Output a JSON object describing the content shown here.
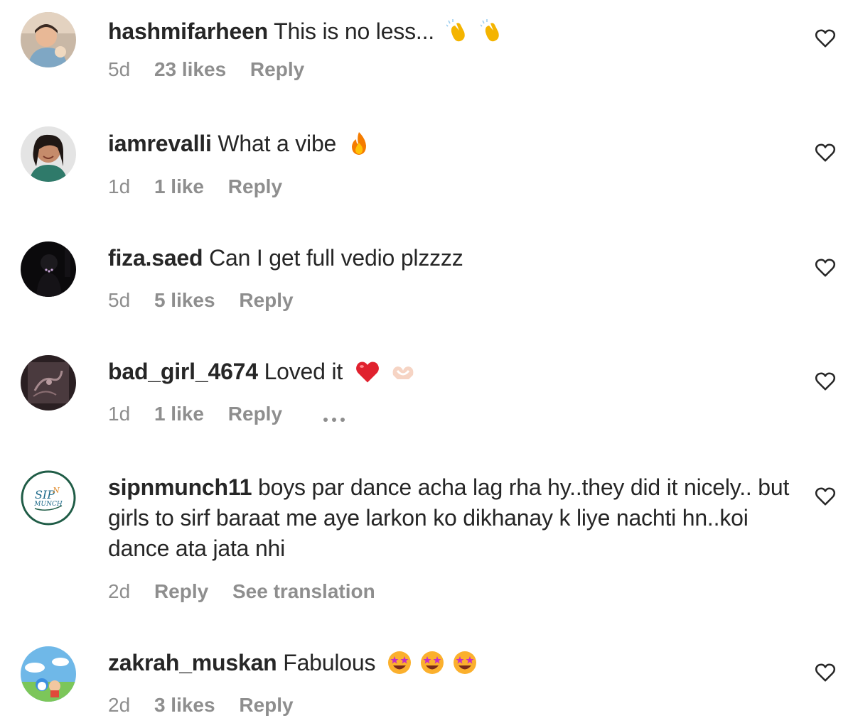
{
  "comments": [
    {
      "username": "hashmifarheen",
      "text": "This is no less...",
      "emojis": [
        "clapping-hands",
        "clapping-hands"
      ],
      "time": "5d",
      "likes": "23 likes",
      "reply": "Reply"
    },
    {
      "username": "iamrevalli",
      "text": "What a vibe",
      "emojis": [
        "fire"
      ],
      "time": "1d",
      "likes": "1 like",
      "reply": "Reply"
    },
    {
      "username": "fiza.saed",
      "text": "Can I get full vedio plzzzz",
      "time": "5d",
      "likes": "5 likes",
      "reply": "Reply"
    },
    {
      "username": "bad_girl_4674",
      "text": "Loved it",
      "emojis": [
        "red-heart",
        "heart-hands"
      ],
      "time": "1d",
      "likes": "1 like",
      "reply": "Reply",
      "more_icon": "more-options-icon"
    },
    {
      "username": "sipnmunch11",
      "text": "boys par dance acha lag rha hy..they did it nicely.. but girls to sirf baraat me aye larkon ko dikhanay k liye nachti hn..koi dance ata jata nhi",
      "time": "2d",
      "reply": "Reply",
      "see_translation": "See translation",
      "avatar_logo_text": "SIP N MUNCH"
    },
    {
      "username": "zakrah_muskan",
      "text": "Fabulous",
      "emojis": [
        "star-struck",
        "star-struck",
        "star-struck"
      ],
      "time": "2d",
      "likes": "3 likes",
      "reply": "Reply"
    }
  ],
  "colors": {
    "text": "#262626",
    "secondary": "#8e8e8e",
    "background": "#ffffff"
  }
}
